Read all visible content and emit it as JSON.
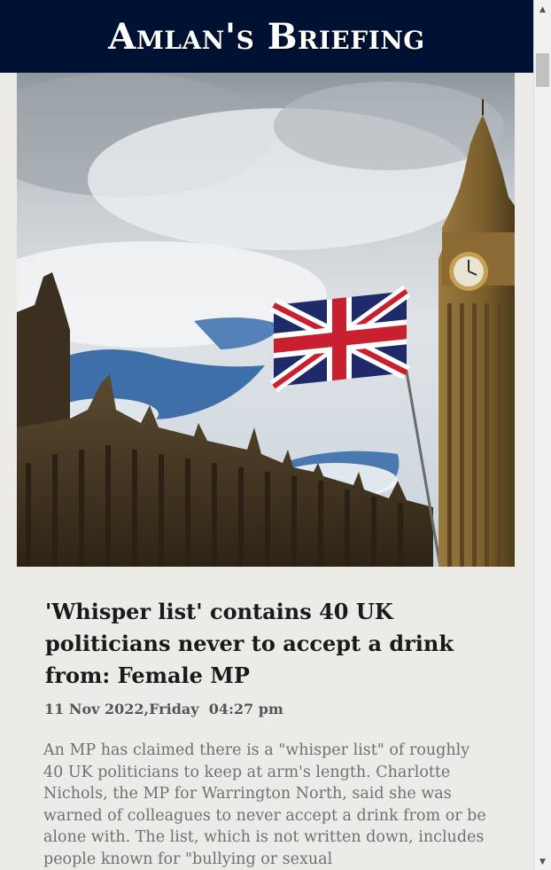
{
  "masthead": {
    "title": "Amlan's Briefing"
  },
  "hero": {
    "alt": "Union flag flying beside the Houses of Parliament and Big Ben"
  },
  "article": {
    "headline": "'Whisper list' contains 40 UK politicians never to accept a drink from: Female MP",
    "date": "11 Nov 2022,Friday",
    "time": "04:27 pm",
    "body": "An MP has claimed there is a \"whisper list\" of roughly 40 UK politicians to keep at arm's length. Charlotte Nichols, the MP for Warrington North, said she was warned of colleagues to never accept a drink from or be alone with. The list, which is not written down, includes people known for \"bullying or sexual"
  },
  "scrollbar": {
    "up_icon": "triangle-up",
    "down_icon": "triangle-down"
  },
  "colors": {
    "masthead_bg": "#001233",
    "page_bg": "#ecebe8",
    "headline": "#1a1a1a",
    "body": "#707070"
  }
}
